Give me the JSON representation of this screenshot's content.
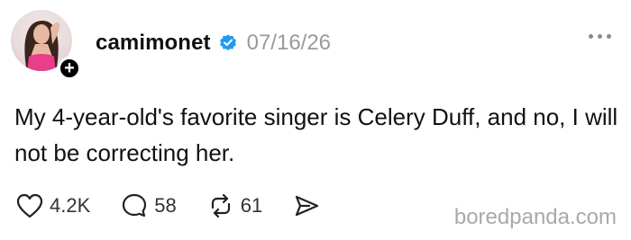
{
  "post": {
    "username": "camimonet",
    "date": "07/16/26",
    "text": "My 4-year-old's favorite singer is Celery Duff, and no, I will not be correcting her.",
    "follow_icon": "+"
  },
  "actions": {
    "likes": "4.2K",
    "replies": "58",
    "reposts": "61"
  },
  "watermark": "boredpanda.com",
  "icons": {
    "verified": "verified-badge-icon",
    "like": "heart-icon",
    "reply": "comment-bubble-icon",
    "repost": "repost-icon",
    "share": "send-icon",
    "more": "more-dots-icon"
  },
  "colors": {
    "verified": "#1d9bf0",
    "date": "#9a9a9a",
    "text": "#111111"
  }
}
